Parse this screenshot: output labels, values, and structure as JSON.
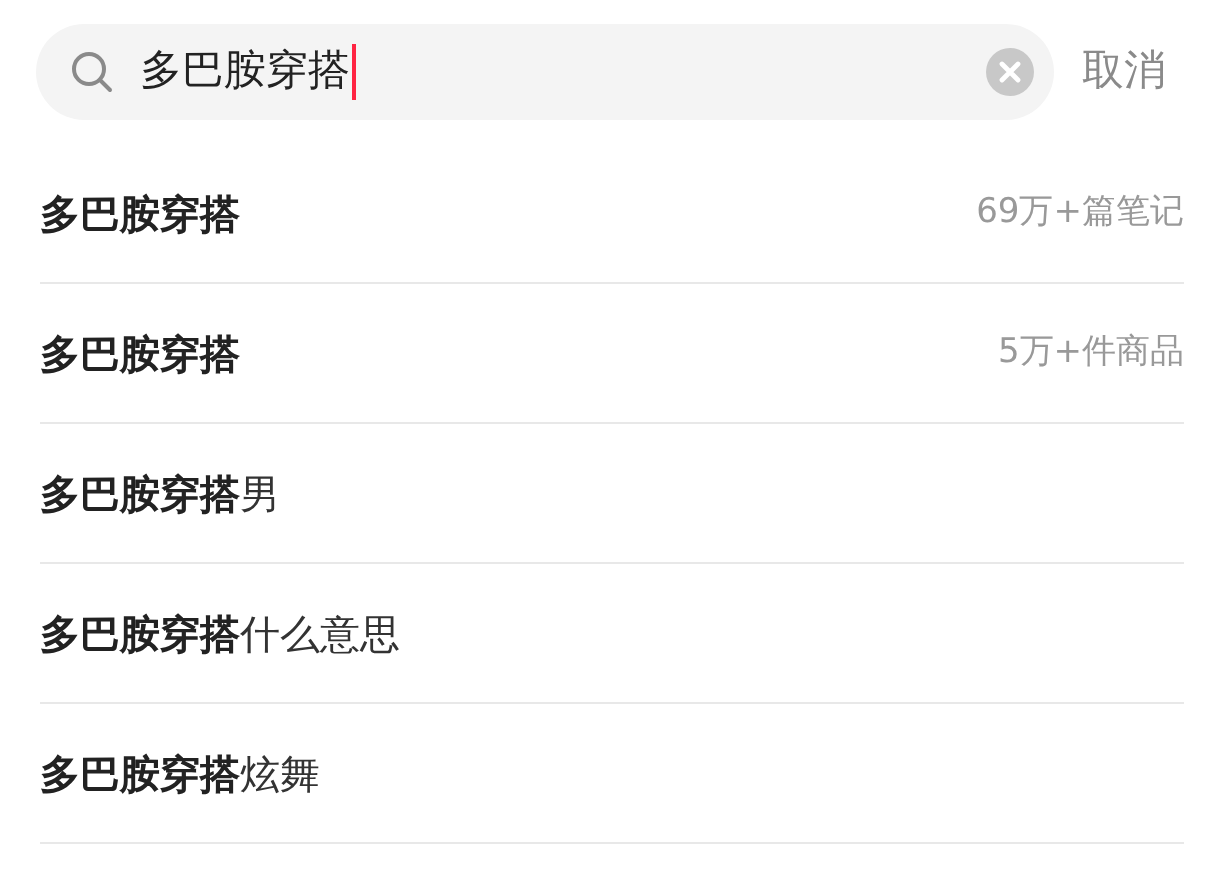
{
  "search": {
    "value": "多巴胺穿搭",
    "cancel": "取消"
  },
  "suggestions": [
    {
      "text": "**多巴胺穿搭**",
      "count": "69万+篇笔记"
    },
    {
      "text": "**多巴胺穿搭**",
      "count": "5万+件商品"
    },
    {
      "text": "**多巴胺穿搭**男"
    },
    {
      "text": "**多巴胺穿搭**什么意思"
    },
    {
      "text": "**多巴胺穿搭**炫舞"
    }
  ]
}
